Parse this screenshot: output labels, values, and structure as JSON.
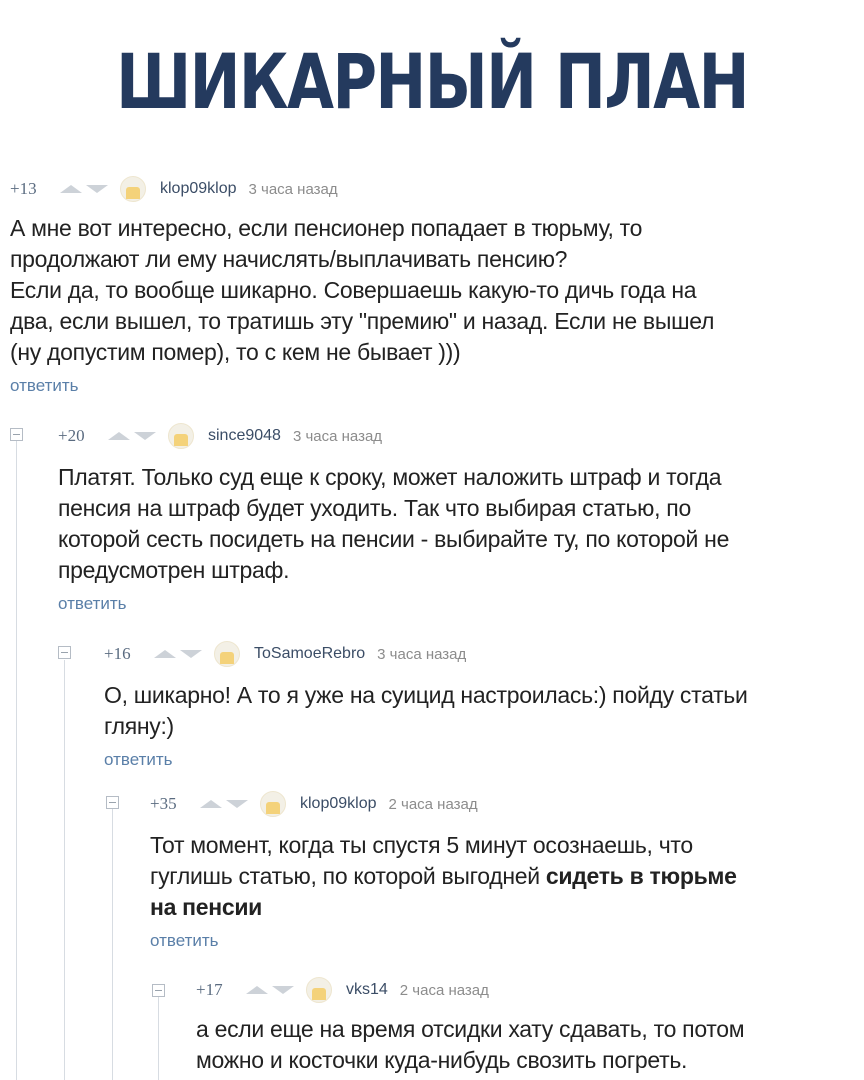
{
  "headline": "ШИКАРНЫЙ ПЛАН",
  "reply_label": "ответить",
  "comments": [
    {
      "rating": "+13",
      "user": "klop09klop",
      "time": "3 часа назад",
      "text_lines": [
        "А мне вот интересно, если пенсионер попадает в тюрьму, то",
        "продолжают ли ему начислять/выплачивать пенсию?",
        "Если да, то вообще шикарно. Совершаешь какую-то дичь года на",
        "два, если вышел, то тратишь эту \"премию\"  и назад. Если не вышел",
        "(ну допустим помер), то с кем не бывает )))"
      ]
    },
    {
      "rating": "+20",
      "user": "since9048",
      "time": "3 часа назад",
      "text_lines": [
        "Платят. Только суд еще к сроку, может наложить штраф и тогда",
        "пенсия на штраф будет уходить. Так что выбирая статью, по",
        "которой сесть посидеть на пенсии - выбирайте ту, по которой не",
        "предусмотрен штраф."
      ]
    },
    {
      "rating": "+16",
      "user": "ToSamoeRebro",
      "time": "3 часа назад",
      "text_lines": [
        "О, шикарно! А то я уже на суицид настроилась:) пойду статьи",
        "гляну:)"
      ]
    },
    {
      "rating": "+35",
      "user": "klop09klop",
      "time": "2 часа назад",
      "text_lines": [
        "Тот момент, когда ты спустя 5 минут осознаешь, что"
      ],
      "line2_plain": "гуглишь статью, по которой выгодней ",
      "line2_bold": "сидеть в тюрьме",
      "line3_bold": "на пенсии"
    },
    {
      "rating": "+17",
      "user": "vks14",
      "time": "2 часа назад",
      "text_lines": [
        "а если еще на время отсидки хату сдавать, то потом",
        "можно и косточки куда-нибудь свозить погреть."
      ]
    }
  ]
}
